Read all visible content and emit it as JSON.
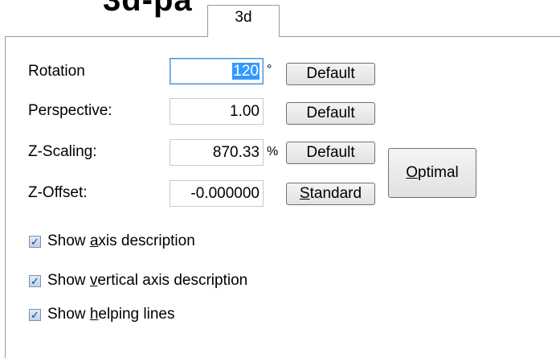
{
  "heading_fragment": "3d-pa",
  "tab": {
    "label": "3d"
  },
  "rows": [
    {
      "label": "Rotation",
      "value": "120",
      "unit": "°",
      "button": "Default"
    },
    {
      "label": "Perspective:",
      "value": "1.00",
      "unit": "",
      "button": "Default"
    },
    {
      "label": "Z-Scaling:",
      "value": "870.33",
      "unit": "%",
      "button": "Default"
    },
    {
      "label": "Z-Offset:",
      "value": "-0.000000",
      "unit": "",
      "button_mnemonic": "S",
      "button_rest": "tandard"
    }
  ],
  "optimal_button": {
    "mnemonic": "O",
    "rest": "ptimal"
  },
  "checkboxes": [
    {
      "pre": "Show ",
      "mnemonic": "a",
      "post": "xis description",
      "checked": true
    },
    {
      "pre": "Show ",
      "mnemonic": "v",
      "post": "ertical axis description",
      "checked": true
    },
    {
      "pre": "Show ",
      "mnemonic": "h",
      "post": "elping lines",
      "checked": true
    }
  ],
  "check_glyph": "✓"
}
